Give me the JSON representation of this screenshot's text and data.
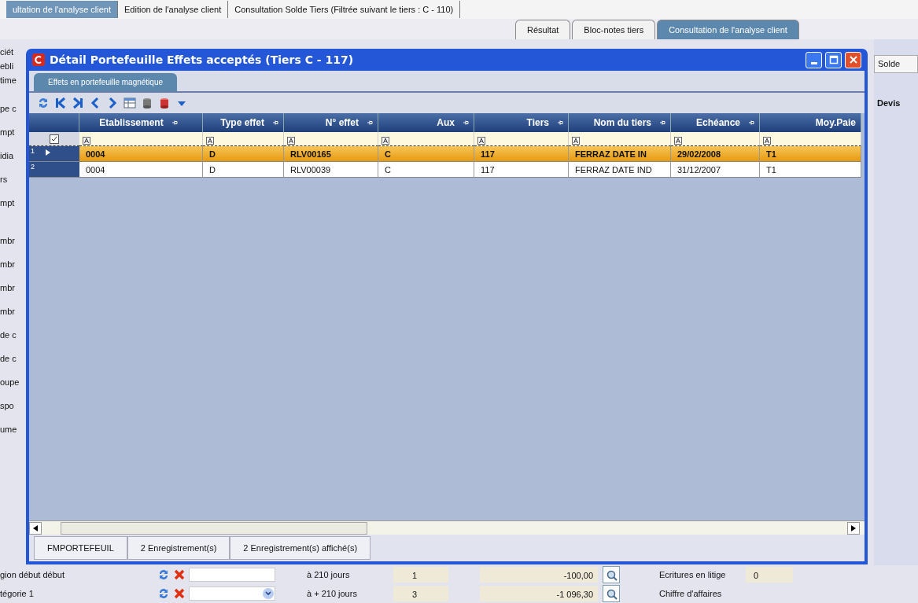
{
  "app_tabs": [
    {
      "label": "ultation de l'analyse client",
      "selected": true
    },
    {
      "label": "Edition de l'analyse client",
      "selected": false
    },
    {
      "label": "Consultation Solde Tiers (Filtrée suivant le tiers : C - 110)",
      "selected": false
    }
  ],
  "sub_tabs": [
    {
      "label": "Résultat",
      "selected": false
    },
    {
      "label": "Bloc-notes tiers",
      "selected": false
    },
    {
      "label": "Consultation de l'analyse client",
      "selected": true
    }
  ],
  "left_panel": {
    "groups": [
      [
        "ciét",
        "ebli",
        "time"
      ],
      [
        "pe c",
        "mpt",
        "idia",
        "rs",
        "mpt"
      ],
      [
        "mbr",
        "mbr",
        "mbr",
        "mbr",
        "de c",
        "de c",
        "oupe",
        "spo",
        "ume"
      ]
    ]
  },
  "right_panel": {
    "tab": "Solde",
    "column_header": "Devis"
  },
  "bottom_rows": [
    {
      "label": "gion début début",
      "dropdown": false,
      "period": "à 210 jours",
      "count": "1",
      "amount": "-100,00",
      "right_label": "Ecritures en litige",
      "right_value": "0"
    },
    {
      "label": "tégorie 1",
      "dropdown": true,
      "period": "à + 210 jours",
      "count": "3",
      "amount": "-1 096,30",
      "right_label": "Chiffre d'affaires"
    }
  ],
  "dialog": {
    "title": "Détail Portefeuille Effets acceptés (Tiers C - 117)",
    "tabs": [
      {
        "label": "Effets en portefeuille magnétique",
        "selected": true
      }
    ],
    "grid": {
      "columns": [
        "Etablissement",
        "Type effet",
        "N° effet",
        "Aux",
        "Tiers",
        "Nom du tiers",
        "Echéance",
        "Moy.Paie"
      ],
      "rows": [
        {
          "number": "1",
          "selected": true,
          "cells": [
            "0004",
            "D",
            "RLV00165",
            "C",
            "117",
            "FERRAZ DATE IN",
            "29/02/2008",
            "T1"
          ]
        },
        {
          "number": "2",
          "selected": false,
          "cells": [
            "0004",
            "D",
            "RLV00039",
            "C",
            "117",
            "FERRAZ DATE IND",
            "31/12/2007",
            "T1"
          ]
        }
      ]
    },
    "status_bar": [
      "FMPORTEFEUIL",
      "2 Enregistrement(s)",
      "2 Enregistrement(s) affiché(s)"
    ]
  }
}
